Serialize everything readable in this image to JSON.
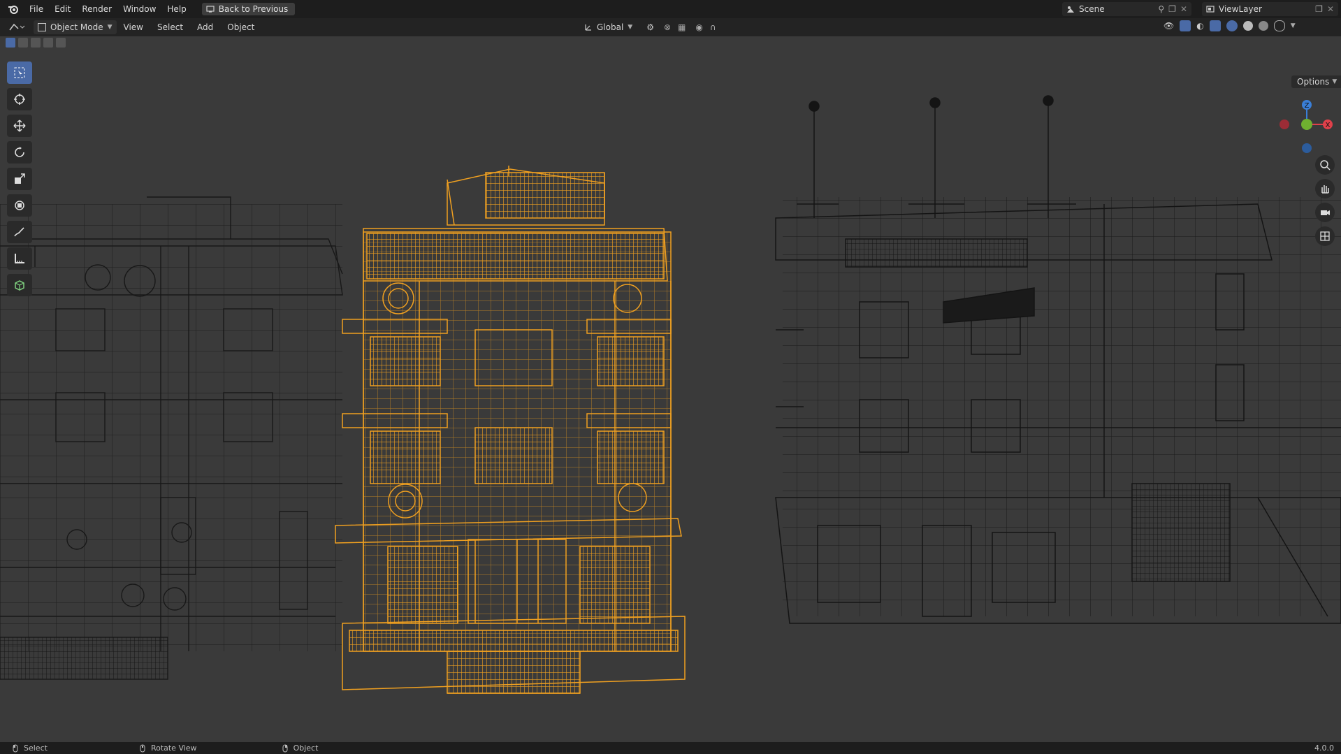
{
  "app": {
    "menus": [
      "File",
      "Edit",
      "Render",
      "Window",
      "Help"
    ],
    "back_button": "Back to Previous",
    "scene": "Scene",
    "view_layer": "ViewLayer",
    "version": "4.0.0"
  },
  "header": {
    "mode": "Object Mode",
    "menus": [
      "View",
      "Select",
      "Add",
      "Object"
    ],
    "orientation": "Global",
    "options_label": "Options"
  },
  "status": {
    "select": "Select",
    "rotate_view": "Rotate View",
    "object": "Object"
  },
  "gizmo": {
    "x_label": "X",
    "y_label": "Y",
    "z_label": "Z"
  },
  "colors": {
    "selected_wire": "#f0a020",
    "unselected_wire": "#141414",
    "x_axis": "#e0404a",
    "y_axis": "#6fb030",
    "z_axis": "#3a7fd8",
    "active_tool": "#4a6aa6"
  },
  "icons": {
    "toolbar": [
      "select-box-icon",
      "cursor-icon",
      "move-icon",
      "rotate-icon",
      "scale-icon",
      "transform-icon",
      "annotate-icon",
      "measure-icon",
      "add-cube-icon"
    ],
    "navtools": [
      "zoom-icon",
      "pan-hand-icon",
      "camera-icon",
      "grid-view-icon"
    ]
  }
}
